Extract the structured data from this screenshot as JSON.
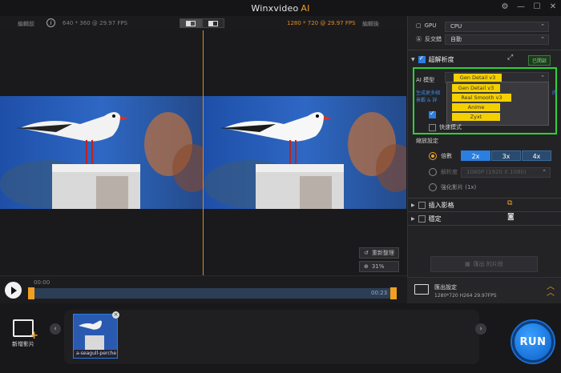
{
  "app": {
    "title": "Winxvideo",
    "title_ai": "AI"
  },
  "preview": {
    "label_before": "編輯前",
    "label_after": "編輯後",
    "res_before": "640 * 360 @ 29.97 FPS",
    "res_after": "1280 * 720 @ 29.97 FPS",
    "reset_label": "重新整理",
    "zoom_label": "31%"
  },
  "panel": {
    "gpu_label": "GPU",
    "gpu_value": "CPU",
    "deinterlace_label": "反交錯",
    "deinterlace_value": "自動",
    "superres_label": "超解析度",
    "superres_badge": "已開啟",
    "ai_model_label": "AI 模型",
    "ai_model_selected": "Gen Detail v3",
    "model_options": [
      "Gen Detail v3",
      "Real Smooth v3",
      "Anime",
      "Zyxt"
    ],
    "desc_line1": "生成更多細",
    "desc_line1b": "的",
    "desc_line2": "景觀 & 詳",
    "fast_mode_label": "快速模式",
    "scale_label": "縮放設定",
    "multiplier_label": "倍數",
    "scale_options": [
      "2x",
      "3x",
      "4x"
    ],
    "resolution_label": "解析度",
    "resolution_value": "1080P (1920 X 1080)",
    "enhance_label": "強化影片 (1x)",
    "interp_label": "插入影格",
    "stab_label": "穩定",
    "export_button": "匯出 的片段",
    "accent": "#f0a020",
    "highlight": "#2fcf3a"
  },
  "timeline": {
    "start": "00:00",
    "end": "00:23"
  },
  "export_settings": {
    "label": "匯出設定",
    "details": "1280*720   H264   29.97FPS"
  },
  "bottom": {
    "add_video": "新增影片",
    "thumb_caption": "a-seagull-perche",
    "run_label": "RUN"
  }
}
